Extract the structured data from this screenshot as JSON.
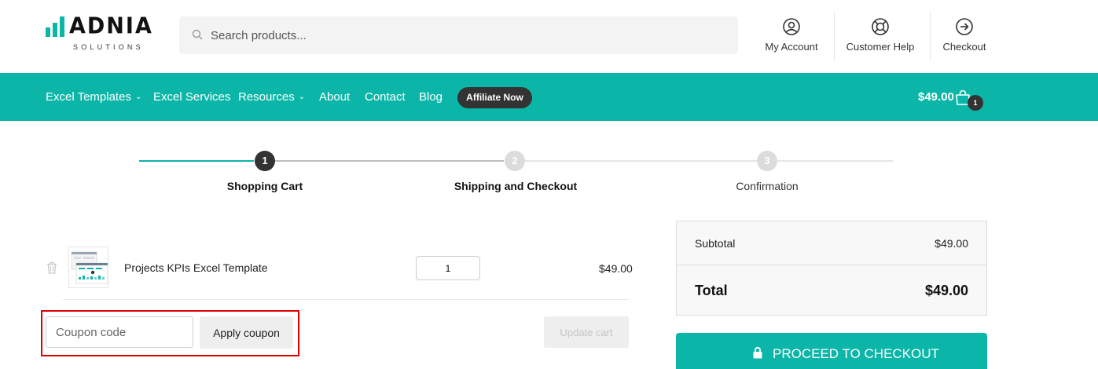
{
  "brand": {
    "name": "ADNIA",
    "tagline": "SOLUTIONS",
    "accent": "#0bb6a8"
  },
  "search": {
    "placeholder": "Search products..."
  },
  "header_links": [
    {
      "label": "My Account",
      "icon": "user-circle-icon"
    },
    {
      "label": "Customer Help",
      "icon": "lifebuoy-icon"
    },
    {
      "label": "Checkout",
      "icon": "arrow-right-circle-icon"
    }
  ],
  "nav": {
    "items": [
      {
        "label": "Excel Templates",
        "has_dropdown": true
      },
      {
        "label": "Excel Services",
        "has_dropdown": false
      },
      {
        "label": "Resources",
        "has_dropdown": true
      },
      {
        "label": "About",
        "has_dropdown": false
      },
      {
        "label": "Contact",
        "has_dropdown": false
      },
      {
        "label": "Blog",
        "has_dropdown": false
      }
    ],
    "cta": "Affiliate Now",
    "cart_total": "$49.00",
    "cart_count": "1"
  },
  "steps": [
    {
      "number": "1",
      "label": "Shopping Cart",
      "state": "active"
    },
    {
      "number": "2",
      "label": "Shipping and Checkout",
      "state": "upcoming"
    },
    {
      "number": "3",
      "label": "Confirmation",
      "state": "upcoming"
    }
  ],
  "cart": {
    "items": [
      {
        "name": "Projects KPIs Excel Template",
        "quantity": "1",
        "price": "$49.00"
      }
    ],
    "coupon_placeholder": "Coupon code",
    "apply_label": "Apply coupon",
    "update_label": "Update cart"
  },
  "totals": {
    "subtotal_label": "Subtotal",
    "subtotal_value": "$49.00",
    "total_label": "Total",
    "total_value": "$49.00",
    "checkout_label": "PROCEED TO CHECKOUT"
  }
}
